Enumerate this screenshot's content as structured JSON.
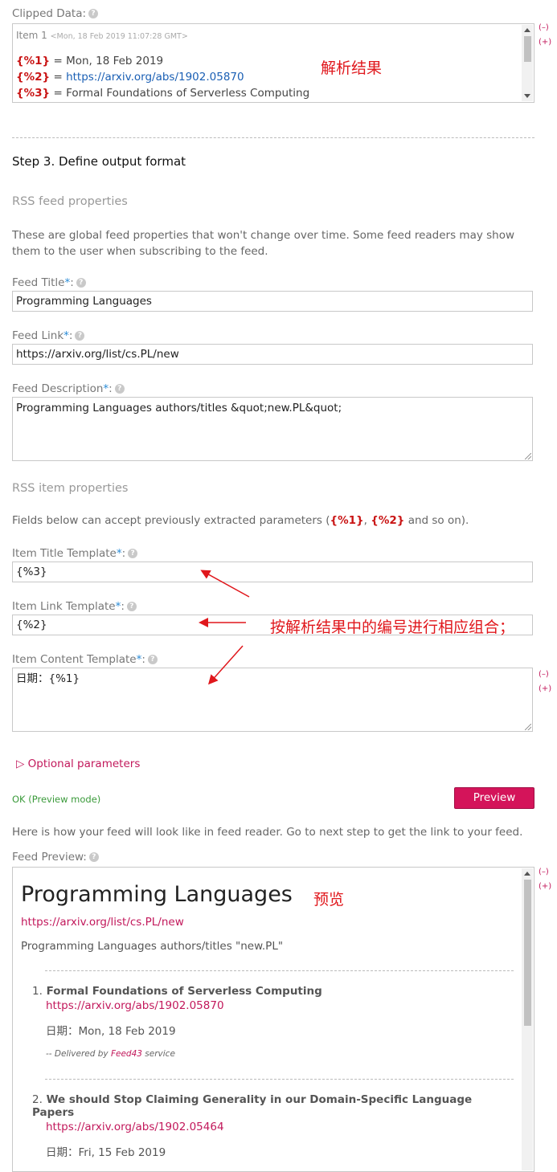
{
  "clipped": {
    "label": "Clipped Data:",
    "item_title": "Item 1",
    "item_date": "<Mon, 18 Feb 2019 11:07:28 GMT>",
    "rows": [
      {
        "key": "{%1}",
        "eq": " = ",
        "value": "Mon, 18 Feb 2019",
        "kind": "text"
      },
      {
        "key": "{%2}",
        "eq": " = ",
        "value": "https://arxiv.org/abs/1902.05870",
        "kind": "link"
      },
      {
        "key": "{%3}",
        "eq": " = ",
        "value": "Formal Foundations of Serverless Computing",
        "kind": "text"
      }
    ],
    "annotation": "解析结果",
    "minus": "(–)",
    "plus": "(+)"
  },
  "step3": {
    "heading": "Step 3. Define output format",
    "rss_feed_props": "RSS feed properties",
    "feed_props_desc": "These are global feed properties that won't change over time. Some feed readers may show them to the user when subscribing to the feed.",
    "feed_title_label": "Feed Title",
    "feed_title_value": "Programming Languages",
    "feed_link_label": "Feed Link",
    "feed_link_value": "https://arxiv.org/list/cs.PL/new",
    "feed_desc_label": "Feed Description",
    "feed_desc_value": "Programming Languages authors/titles &quot;new.PL&quot;",
    "rss_item_props": "RSS item properties",
    "item_props_desc_pre": "Fields below can accept previously extracted parameters (",
    "item_props_p1": "{%1}",
    "item_props_sep": ", ",
    "item_props_p2": "{%2}",
    "item_props_desc_post": " and so on).",
    "item_title_label": "Item Title Template",
    "item_title_value": "{%3}",
    "item_link_label": "Item Link Template",
    "item_link_value": "{%2}",
    "item_content_label": "Item Content Template",
    "item_content_value": "日期：{%1}",
    "annotation_combine": "按解析结果中的编号进行相应组合；",
    "required_mark": "*",
    "colon": ":",
    "optional_params": "▷ Optional parameters",
    "ok_status": "OK (Preview mode)",
    "preview_button": "Preview",
    "preview_note": "Here is how your feed will look like in feed reader. Go to next step to get the link to your feed.",
    "feed_preview_label": "Feed Preview:"
  },
  "preview": {
    "title": "Programming Languages",
    "annotation": "预览",
    "link": "https://arxiv.org/list/cs.PL/new",
    "description": "Programming Languages authors/titles \"new.PL\"",
    "items": [
      {
        "num": "1.",
        "title": "Formal Foundations of Serverless Computing",
        "link": "https://arxiv.org/abs/1902.05870",
        "date": "日期：Mon, 18 Feb 2019"
      },
      {
        "num": "2.",
        "title": "We should Stop Claiming Generality in our Domain-Specific Language Papers",
        "link": "https://arxiv.org/abs/1902.05464",
        "date": "日期：Fri, 15 Feb 2019"
      }
    ],
    "delivered_pre": "-- Delivered by ",
    "delivered_brand": "Feed43",
    "delivered_post": " service"
  },
  "colors": {
    "accent": "#c2185b",
    "param_red": "#c91414",
    "link_blue": "#1a5fb4",
    "annotation_red": "#e0171c",
    "ok_green": "#3a9a3a"
  }
}
